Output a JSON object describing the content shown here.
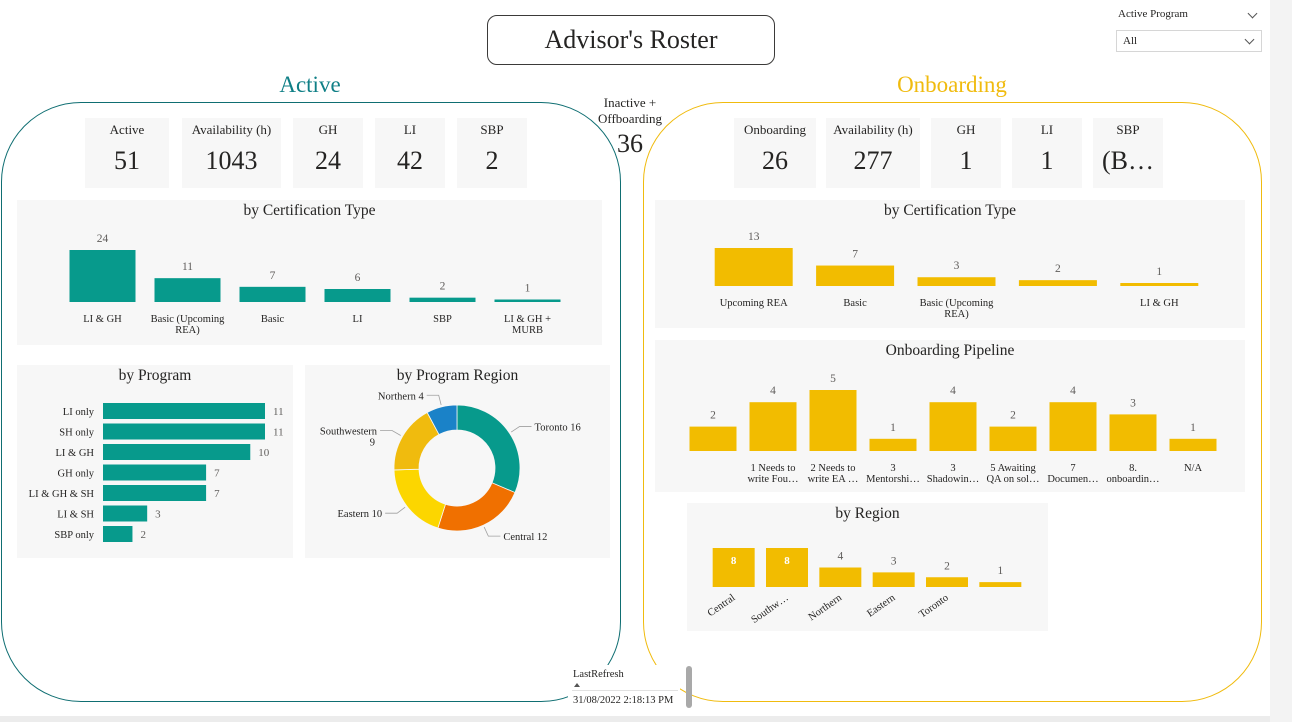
{
  "header": {
    "title": "Advisor's Roster"
  },
  "slicer": {
    "label": "Active Program",
    "value": "All"
  },
  "inactive": {
    "label_line1": "Inactive +",
    "label_line2": "Offboarding",
    "value": "36"
  },
  "refresh": {
    "label": "LastRefresh",
    "value": "31/08/2022 2:18:13 PM"
  },
  "colors": {
    "teal": "#079a8c",
    "yellow": "#f2bc00",
    "orange": "#f07000",
    "blue": "#1a82c8",
    "gold": "#f0bb0e",
    "yellow_light": "#fcd600"
  },
  "active": {
    "heading": "Active",
    "cards": [
      {
        "label": "Active",
        "value": "51"
      },
      {
        "label": "Availability (h)",
        "value": "1043"
      },
      {
        "label": "GH",
        "value": "24"
      },
      {
        "label": "LI",
        "value": "42"
      },
      {
        "label": "SBP",
        "value": "2"
      }
    ],
    "cert_title": "by Certification Type",
    "program_title": "by Program",
    "region_title": "by Program Region"
  },
  "onboarding": {
    "heading": "Onboarding",
    "cards": [
      {
        "label": "Onboarding",
        "value": "26"
      },
      {
        "label": "Availability (h)",
        "value": "277"
      },
      {
        "label": "GH",
        "value": "1"
      },
      {
        "label": "LI",
        "value": "1"
      },
      {
        "label": "SBP",
        "value": "(B…"
      }
    ],
    "cert_title": "by Certification Type",
    "pipeline_title": "Onboarding Pipeline",
    "region_title": "by Region"
  },
  "chart_data": [
    {
      "id": "active_cert",
      "type": "bar",
      "title": "by Certification Type",
      "categories": [
        "LI & GH",
        "Basic (Upcoming REA)",
        "Basic",
        "LI",
        "SBP",
        "LI & GH + MURB"
      ],
      "category_lines": [
        [
          "LI & GH"
        ],
        [
          "Basic (Upcoming",
          "REA)"
        ],
        [
          "Basic"
        ],
        [
          "LI"
        ],
        [
          "SBP"
        ],
        [
          "LI & GH +",
          "MURB"
        ]
      ],
      "values": [
        24,
        11,
        7,
        6,
        2,
        1
      ],
      "ylim": [
        0,
        24
      ],
      "grid": false
    },
    {
      "id": "active_program",
      "type": "bar",
      "orientation": "horizontal",
      "title": "by Program",
      "categories": [
        "LI only",
        "SH only",
        "LI & GH",
        "GH only",
        "LI & GH & SH",
        "LI & SH",
        "SBP only"
      ],
      "values": [
        11,
        11,
        10,
        7,
        7,
        3,
        2
      ],
      "xlim": [
        0,
        11
      ],
      "grid": false
    },
    {
      "id": "active_region",
      "type": "pie",
      "donut": true,
      "title": "by Program Region",
      "categories": [
        "Toronto",
        "Central",
        "Eastern",
        "Southwestern",
        "Northern"
      ],
      "values": [
        16,
        12,
        10,
        9,
        4
      ],
      "labels": [
        "Toronto 16",
        "Central 12",
        "Eastern 10",
        "Southwestern",
        "Northern 4"
      ],
      "label_extra": [
        "",
        "",
        "",
        "9",
        ""
      ]
    },
    {
      "id": "onb_cert",
      "type": "bar",
      "title": "by Certification Type",
      "categories": [
        "Upcoming REA",
        "Basic",
        "Basic (Upcoming REA)",
        "",
        "LI & GH"
      ],
      "category_lines": [
        [
          "Upcoming REA"
        ],
        [
          "Basic"
        ],
        [
          "Basic (Upcoming",
          "REA)"
        ],
        [],
        [
          "LI & GH"
        ]
      ],
      "values": [
        13,
        7,
        3,
        2,
        1
      ],
      "ylim": [
        0,
        13
      ],
      "grid": false
    },
    {
      "id": "onb_pipeline",
      "type": "bar",
      "title": "Onboarding Pipeline",
      "categories": [
        "",
        "1 Needs to write Fou…",
        "2 Needs to write EA …",
        "3 Mentorshi…",
        "3 Shadowin…",
        "5 Awaiting QA on sol…",
        "7 Documen…",
        "8. onboardin…",
        "N/A"
      ],
      "category_lines": [
        [],
        [
          "1 Needs to",
          "write Fou…"
        ],
        [
          "2 Needs to",
          "write EA …"
        ],
        [
          "3",
          "Mentorshi…"
        ],
        [
          "3",
          "Shadowin…"
        ],
        [
          "5 Awaiting",
          "QA on sol…"
        ],
        [
          "7",
          "Documen…"
        ],
        [
          "8.",
          "onboardin…"
        ],
        [
          "N/A"
        ]
      ],
      "values": [
        2,
        4,
        5,
        1,
        4,
        2,
        4,
        3,
        1
      ],
      "ylim": [
        0,
        5
      ],
      "grid": false
    },
    {
      "id": "onb_region",
      "type": "bar",
      "title": "by Region",
      "categories": [
        "Central",
        "Southw…",
        "Northern",
        "Eastern",
        "Toronto",
        ""
      ],
      "values": [
        8,
        8,
        4,
        3,
        2,
        1
      ],
      "ylim": [
        0,
        8
      ],
      "grid": false
    }
  ]
}
